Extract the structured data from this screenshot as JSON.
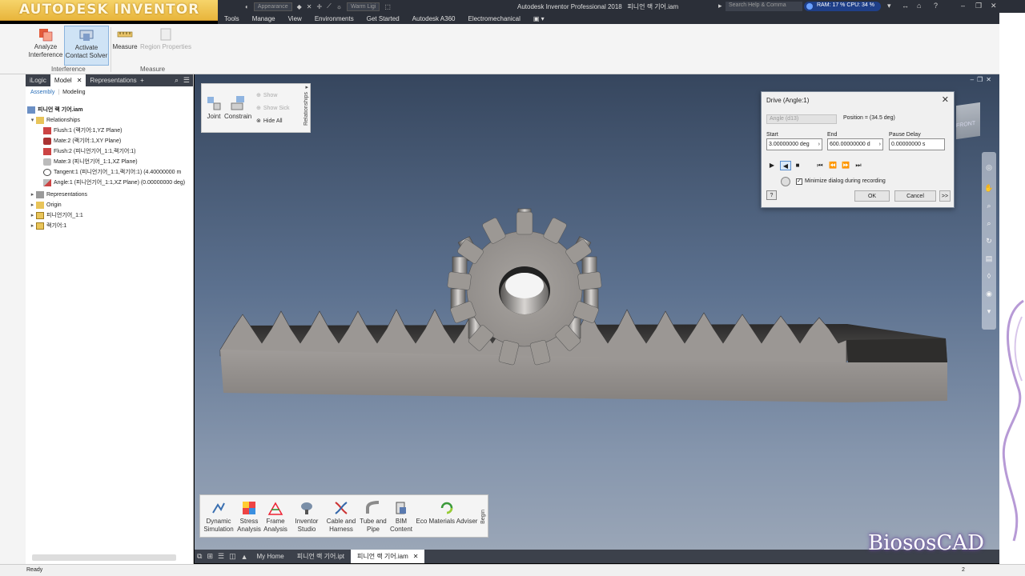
{
  "brand": "AUTODESK INVENTOR",
  "title_bar": {
    "appearance_value": "Appearance",
    "lighting_value": "Warm Ligi",
    "app_title": "Autodesk Inventor Professional 2018",
    "doc_title": "피니언 랙 기어.iam",
    "search_placeholder": "Search Help & Comma",
    "perf": "RAM: 17 %  CPU: 34 %"
  },
  "ribbon_tabs": [
    "Tools",
    "Manage",
    "View",
    "Environments",
    "Get Started",
    "Autodesk A360",
    "Electromechanical"
  ],
  "ribbon": {
    "analyze_line1": "Analyze",
    "analyze_line2": "Interference",
    "activate_line1": "Activate",
    "activate_line2": "Contact Solver",
    "measure": "Measure",
    "region_properties": "Region Properties",
    "group_interference": "Interference",
    "group_measure": "Measure"
  },
  "browser": {
    "tabs": [
      "iLogic",
      "Model",
      "Representations"
    ],
    "sub_assembly": "Assembly",
    "sub_modeling": "Modeling",
    "items": [
      {
        "label": "피니언 랙 기어.iam"
      },
      {
        "label": "Relationships"
      },
      {
        "label": "Flush:1 (랙기어:1,YZ Plane)"
      },
      {
        "label": "Mate:2 (랙기어:1,XY Plane)"
      },
      {
        "label": "Flush:2 (피니언기어_1:1,랙기어:1)"
      },
      {
        "label": "Mate:3 (피니언기어_1:1,XZ Plane)"
      },
      {
        "label": "Tangent:1 (피니언기어_1:1,랙기어:1) (4.40000000 m"
      },
      {
        "label": "Angle:1 (피니언기어_1:1,XZ Plane) (0.00000000 deg)"
      },
      {
        "label": "Representations"
      },
      {
        "label": "Origin"
      },
      {
        "label": "피니언기어_1:1"
      },
      {
        "label": "랙기어:1"
      }
    ]
  },
  "relationships_panel": {
    "joint": "Joint",
    "constrain": "Constrain",
    "show": "Show",
    "show_sick": "Show Sick",
    "hide_all": "Hide All",
    "title": "Relationships"
  },
  "drive_dialog": {
    "title": "Drive (Angle:1)",
    "constraint_value": "Angle (d13)",
    "position": "Position = (34.5 deg)",
    "start_label": "Start",
    "start_value": "3.00000000 deg",
    "end_label": "End",
    "end_value": "600.00000000 d",
    "pause_label": "Pause Delay",
    "pause_value": "0.00000000 s",
    "minimize_label": "Minimize dialog during recording",
    "minimize_checked": true,
    "ok": "OK",
    "cancel": "Cancel",
    "more": ">>"
  },
  "viewcube_label": "FRONT",
  "environments": [
    {
      "line1": "Dynamic",
      "line2": "Simulation"
    },
    {
      "line1": "Stress",
      "line2": "Analysis"
    },
    {
      "line1": "Frame",
      "line2": "Analysis"
    },
    {
      "line1": "Inventor",
      "line2": "Studio"
    },
    {
      "line1": "Cable and",
      "line2": "Harness"
    },
    {
      "line1": "Tube and",
      "line2": "Pipe"
    },
    {
      "line1": "BIM",
      "line2": "Content"
    },
    {
      "line1": "Eco Materials Adviser",
      "line2": ""
    }
  ],
  "env_begin": "Begin",
  "doc_tabs": [
    "My Home",
    "피니언 랙 기어.ipt",
    "피니언 랙 기어.iam"
  ],
  "status": {
    "text": "Ready",
    "right": "2"
  },
  "watermark": "BiososCAD",
  "colors": {
    "titlebar": "#2b2f38",
    "accent": "#1f3f88",
    "brand": "#e8b53c"
  }
}
